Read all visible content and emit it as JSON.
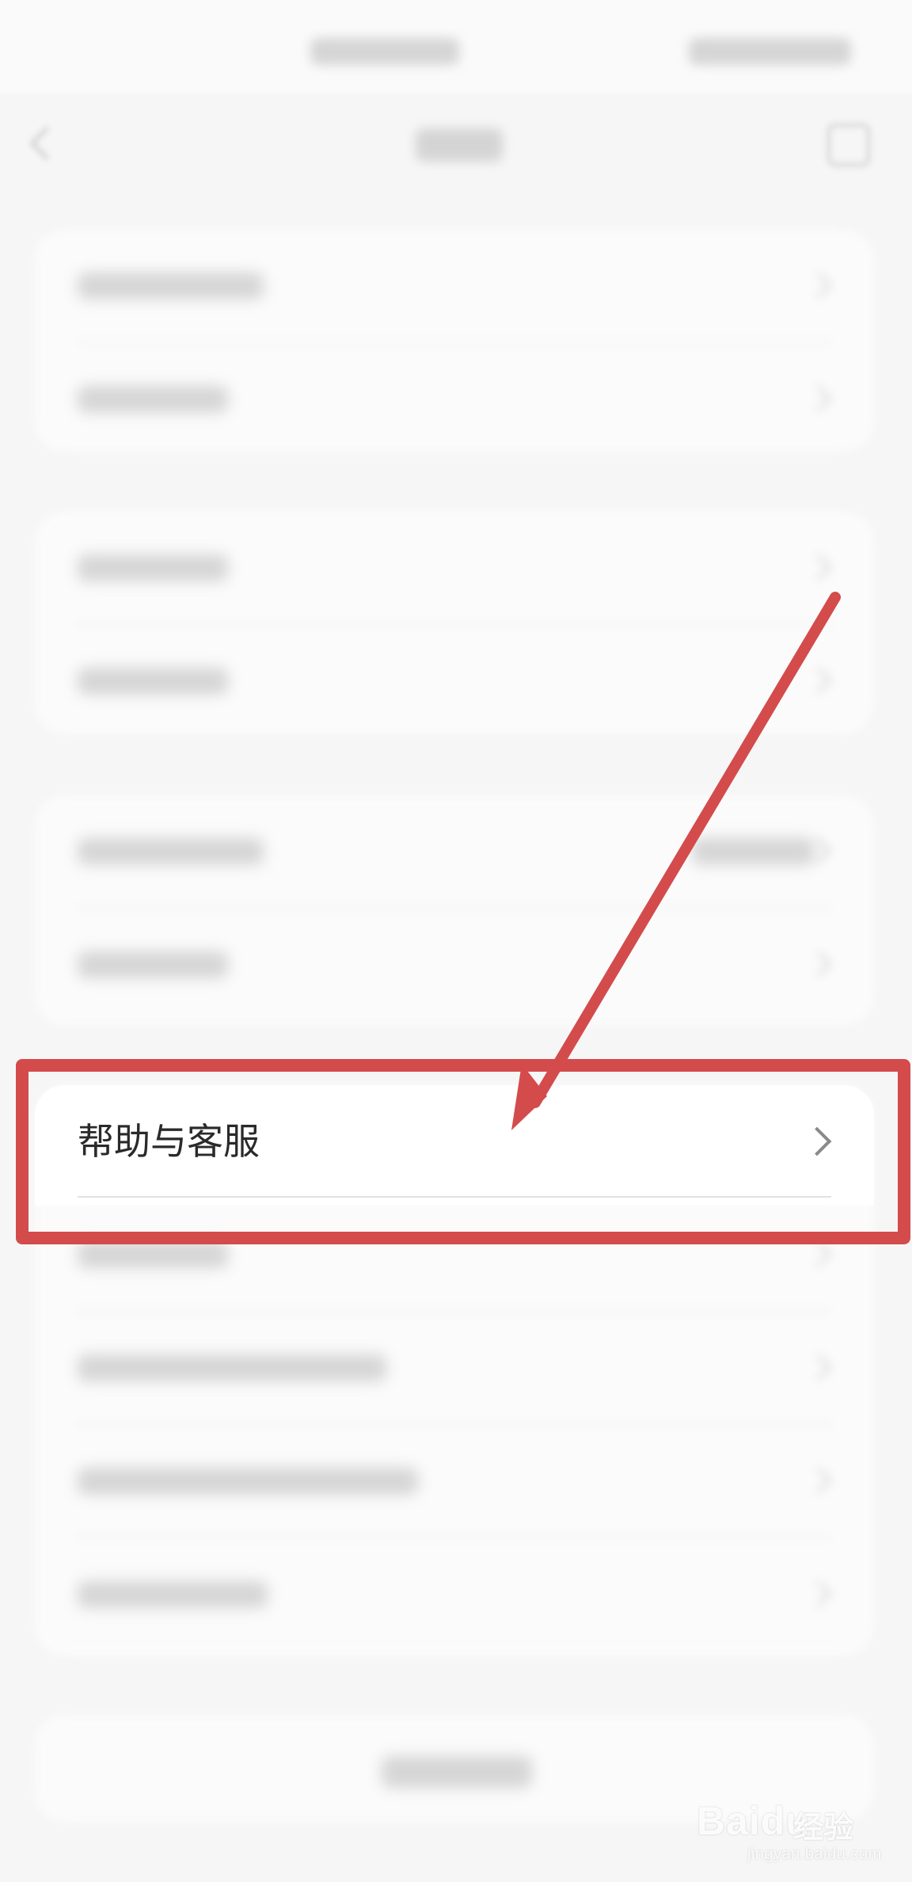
{
  "screen": {
    "highlighted_item": {
      "label": "帮助与客服",
      "icon": "chevron-right-icon"
    },
    "annotation": {
      "color": "#d44b4c"
    },
    "watermark": {
      "brand": "Baidu",
      "product": "经验",
      "site": "jingyan.baidu.com"
    }
  }
}
